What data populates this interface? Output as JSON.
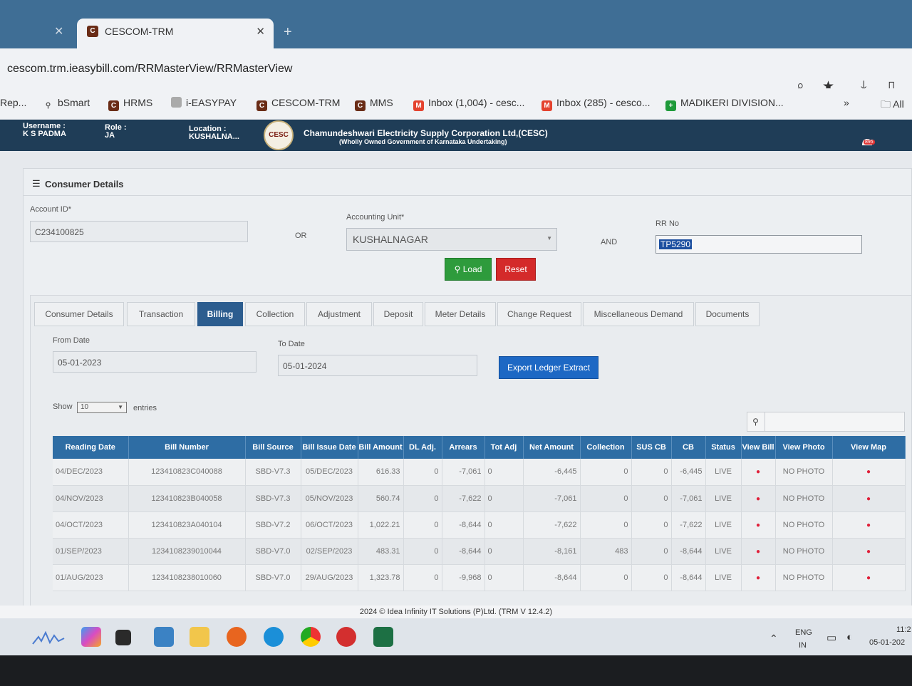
{
  "browser": {
    "tab_title": "CESCOM-TRM",
    "url": "cescom.trm.ieasybill.com/RRMasterView/RRMasterView",
    "bookmarks": [
      "Rep...",
      "bSmart",
      "HRMS",
      "i-EASYPAY",
      "CESCOM-TRM",
      "MMS",
      "Inbox (1,004) - cesc...",
      "Inbox (285) - cesco...",
      "MADIKERI DIVISION..."
    ],
    "bookmarks_all": "All"
  },
  "header": {
    "username_label": "Username :",
    "username": "K S PADMA",
    "role_label": "Role :",
    "role": "JA",
    "location_label": "Location :",
    "location": "KUSHALNA...",
    "org_name": "Chamundeshwari Electricity Supply Corporation Ltd,(CESC)",
    "org_sub": "(Wholly Owned Government of Karnataka Undertaking)",
    "logo_text": "CESC",
    "notif_count": "895"
  },
  "consumer": {
    "panel_title": "Consumer Details",
    "account_label": "Account ID*",
    "account_value": "C234100825",
    "or_text": "OR",
    "unit_label": "Accounting Unit*",
    "unit_value": "KUSHALNAGAR",
    "and_text": "AND",
    "rr_label": "RR No",
    "rr_value": "TP5290",
    "load_label": "Load",
    "reset_label": "Reset"
  },
  "tabs": [
    "Consumer Details",
    "Transaction",
    "Billing",
    "Collection",
    "Adjustment",
    "Deposit",
    "Meter Details",
    "Change Request",
    "Miscellaneous Demand",
    "Documents"
  ],
  "billing": {
    "from_label": "From Date",
    "from_value": "05-01-2023",
    "to_label": "To Date",
    "to_value": "05-01-2024",
    "export_label": "Export Ledger Extract",
    "show_label": "Show",
    "show_value": "10",
    "entries_label": "entries"
  },
  "table": {
    "columns": [
      "Reading Date",
      "Bill Number",
      "Bill Source",
      "Bill Issue Date",
      "Bill Amount",
      "DL Adj.",
      "Arrears",
      "Tot Adj",
      "Net Amount",
      "Collection",
      "SUS CB",
      "CB",
      "Status",
      "View Bill",
      "View Photo",
      "View Map"
    ],
    "rows": [
      [
        "04/DEC/2023",
        "123410823C040088",
        "SBD-V7.3",
        "05/DEC/2023",
        "616.33",
        "0",
        "-7,061",
        "0",
        "-6,445",
        "0",
        "0",
        "-6,445",
        "LIVE",
        "NO PHOTO"
      ],
      [
        "04/NOV/2023",
        "123410823B040058",
        "SBD-V7.3",
        "05/NOV/2023",
        "560.74",
        "0",
        "-7,622",
        "0",
        "-7,061",
        "0",
        "0",
        "-7,061",
        "LIVE",
        "NO PHOTO"
      ],
      [
        "04/OCT/2023",
        "123410823A040104",
        "SBD-V7.2",
        "06/OCT/2023",
        "1,022.21",
        "0",
        "-8,644",
        "0",
        "-7,622",
        "0",
        "0",
        "-7,622",
        "LIVE",
        "NO PHOTO"
      ],
      [
        "01/SEP/2023",
        "1234108239010044",
        "SBD-V7.0",
        "02/SEP/2023",
        "483.31",
        "0",
        "-8,644",
        "0",
        "-8,161",
        "483",
        "0",
        "-8,644",
        "LIVE",
        "NO PHOTO"
      ],
      [
        "01/AUG/2023",
        "1234108238010060",
        "SBD-V7.0",
        "29/AUG/2023",
        "1,323.78",
        "0",
        "-9,968",
        "0",
        "-8,644",
        "0",
        "0",
        "-8,644",
        "LIVE",
        "NO PHOTO"
      ]
    ]
  },
  "footer": "2024 © Idea Infinity IT Solutions (P)Ltd. (TRM V 12.4.2)",
  "taskbar": {
    "lang_top": "ENG",
    "lang_bottom": "IN",
    "time": "11:2",
    "date": "05-01-202"
  }
}
